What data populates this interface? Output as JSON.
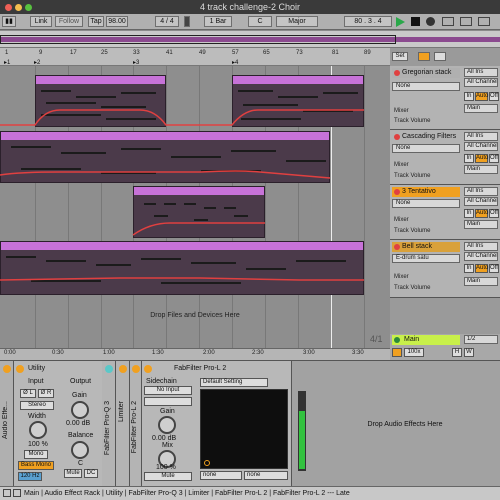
{
  "window": {
    "title": "4 track challenge-2 Choir"
  },
  "control_bar": {
    "link": "Link",
    "follow": "Follow",
    "tap": "Tap",
    "tempo": "98.00",
    "signature": "4 / 4",
    "quantize": "1 Bar",
    "key": "C",
    "scale": "Major",
    "position": "80 .   3 .   4"
  },
  "ruler": {
    "bars": [
      "1",
      "9",
      "17",
      "25",
      "33",
      "41",
      "49",
      "57",
      "65",
      "73",
      "81",
      "89"
    ],
    "locators": [
      "1",
      "2",
      "3",
      "4"
    ]
  },
  "tracks": [
    {
      "name": "Gregorian stack",
      "color": "#f0a020",
      "device": "None",
      "routing_in": "All Ins",
      "routing_ch": "All Channels",
      "mixer": "Mixer",
      "output": "Main",
      "param": "Track Volume",
      "in": "In",
      "auto": "Auto",
      "off": "Off"
    },
    {
      "name": "Cascading Filters",
      "color": "#c772d8",
      "device": "None",
      "routing_in": "All Ins",
      "routing_ch": "All Channels",
      "mixer": "Mixer",
      "output": "Main",
      "param": "Track Volume",
      "in": "In",
      "auto": "Auto",
      "off": "Off"
    },
    {
      "name": "3 Tentativo",
      "color": "#f0a020",
      "device": "None",
      "routing_in": "All Ins",
      "routing_ch": "All Channels",
      "mixer": "Mixer",
      "output": "Main",
      "param": "Track Volume",
      "in": "In",
      "auto": "Auto",
      "off": "Off"
    },
    {
      "name": "Bell stack",
      "color": "#e0a020",
      "device": "E-drum satu",
      "routing_in": "All Ins",
      "routing_ch": "All Channels",
      "mixer": "Mixer",
      "output": "Main",
      "param": "Track Volume",
      "in": "In",
      "auto": "Auto",
      "off": "Off"
    }
  ],
  "drop_files": "Drop Files and Devices Here",
  "zoom_ratio": "4/1",
  "timeline": [
    "0:00",
    "0:30",
    "1:00",
    "1:30",
    "2:00",
    "2:30",
    "3:00",
    "3:30"
  ],
  "main_track": {
    "name": "Main",
    "ratio": "1/2",
    "zoom": "100x",
    "h": "H",
    "w": "W"
  },
  "set_button": "Set",
  "utility": {
    "title": "Utility",
    "input": "Input",
    "output": "Output",
    "phase_l": "Ø L",
    "phase_r": "Ø R",
    "mode": "Stereo",
    "width_label": "Width",
    "width_value": "100 %",
    "mono": "Mono",
    "bass_mono": "Bass Mono",
    "bass_freq": "120 Hz",
    "gain_label": "Gain",
    "gain_value": "0.00 dB",
    "balance_label": "Balance",
    "balance_value": "C",
    "mute": "Mute",
    "dc": "DC"
  },
  "rack_label": "Audio Effe...",
  "collapsed_devices": [
    "FabFilter Pro-Q 3",
    "Limiter",
    "FabFilter Pro-L 2"
  ],
  "pro_l2": {
    "title": "FabFilter Pro-L 2",
    "sidechain": "Sidechain",
    "sidechain_input": "No Input",
    "preset": "Default Setting",
    "gain_label": "Gain",
    "gain_value": "0.00 dB",
    "mix_label": "Mix",
    "mix_value": "100 %",
    "mute": "Mute",
    "sel_a": "none",
    "sel_b": "none"
  },
  "drop_audio": "Drop Audio Effects Here",
  "status": "Main | Audio Effect Rack | Utility | FabFilter Pro-Q 3 | Limiter | FabFilter Pro-L 2 | FabFilter Pro-L 2 --- Late"
}
